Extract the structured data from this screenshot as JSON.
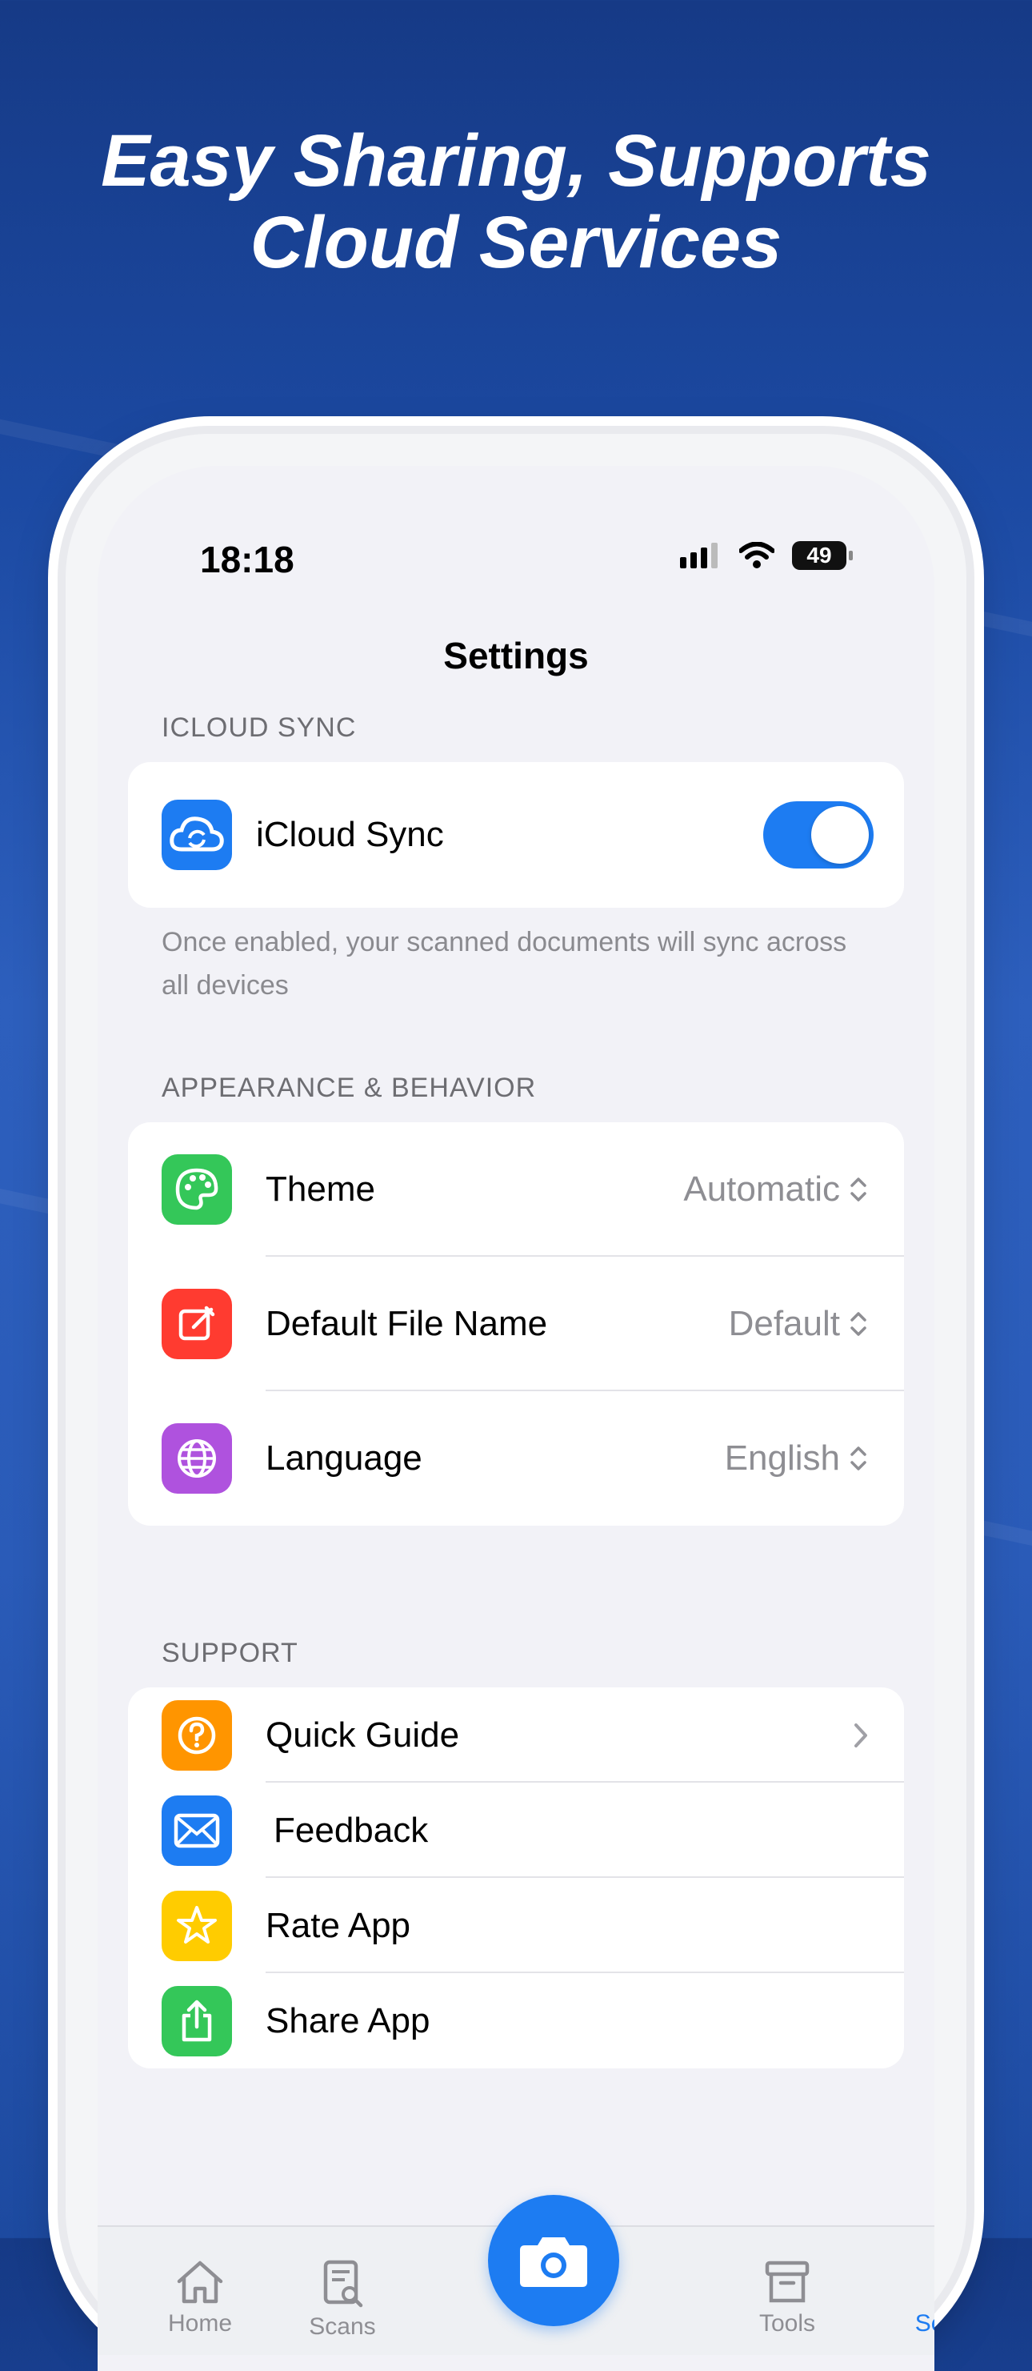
{
  "headline": {
    "line1": "Easy Sharing, Supports",
    "line2": "Cloud Services"
  },
  "status_bar": {
    "time": "18:18",
    "battery": "49"
  },
  "nav": {
    "title": "Settings"
  },
  "icloud_section": {
    "header": "ICLOUD SYNC",
    "row": {
      "label": "iCloud Sync",
      "toggle_on": true
    },
    "footnote": "Once enabled, your scanned documents will sync across all devices"
  },
  "appearance_section": {
    "header": "APPEARANCE & BEHAVIOR",
    "rows": [
      {
        "label": "Theme",
        "value": "Automatic",
        "icon": "palette-icon",
        "color": "#34c759"
      },
      {
        "label": "Default File Name",
        "value": "Default",
        "icon": "edit-icon",
        "color": "#ff3b30"
      },
      {
        "label": "Language",
        "value": "English",
        "icon": "globe-icon",
        "color": "#af52de"
      }
    ]
  },
  "support_section": {
    "header": "SUPPORT",
    "rows": [
      {
        "label": "Quick Guide",
        "icon": "question-icon",
        "color": "#ff9500"
      },
      {
        "label": "Feedback",
        "icon": "mail-icon",
        "color": "#1d7cf2"
      },
      {
        "label": "Rate App",
        "icon": "star-icon",
        "color": "#ffcc00"
      },
      {
        "label": "Share App",
        "icon": "share-icon",
        "color": "#34c759"
      }
    ]
  },
  "tabbar": {
    "tabs": [
      {
        "label": "Home",
        "icon": "home-icon"
      },
      {
        "label": "Scans",
        "icon": "scans-icon"
      },
      {
        "label": "Tools",
        "icon": "tools-icon"
      },
      {
        "label": "Settings",
        "icon": "person-icon",
        "active": true
      }
    ],
    "center_icon": "camera-icon"
  },
  "colors": {
    "accent": "#1d7cf2",
    "background_blue": "#1c4aa3"
  }
}
